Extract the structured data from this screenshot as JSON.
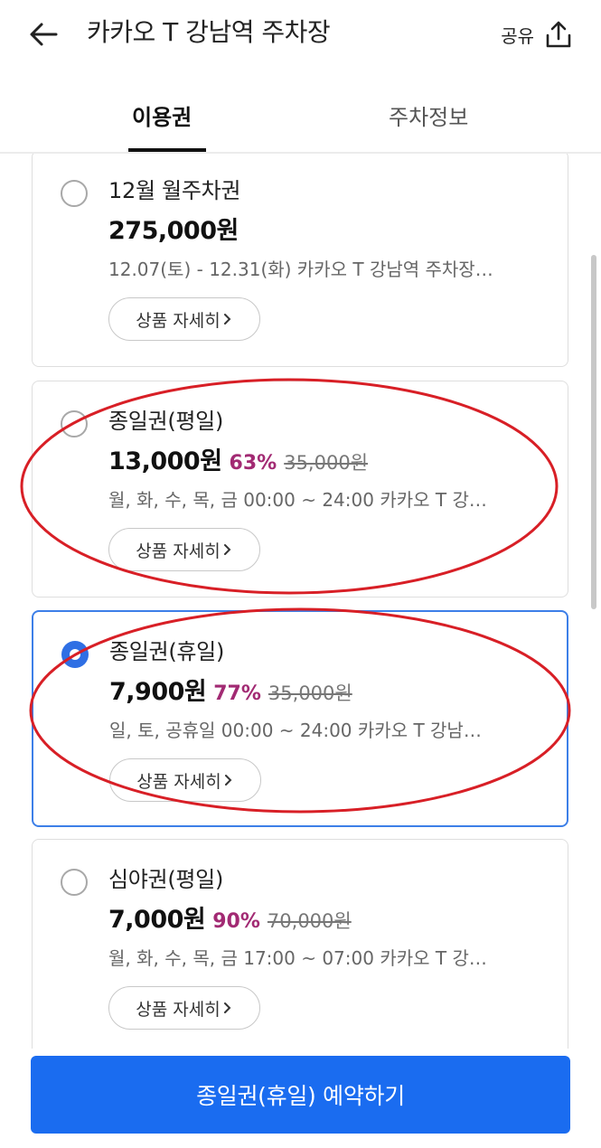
{
  "header": {
    "title": "카카오 T 강남역 주차장",
    "share_label": "공유"
  },
  "tabs": [
    {
      "label": "이용권",
      "active": true
    },
    {
      "label": "주차정보",
      "active": false
    }
  ],
  "tickets": [
    {
      "name": "12월 월주차권",
      "price": "275,000원",
      "discount": "",
      "original_price": "",
      "description": "12.07(토) - 12.31(화) 카카오 T 강남역 주차장…",
      "detail_label": "상품 자세히",
      "selected": false
    },
    {
      "name": "종일권(평일)",
      "price": "13,000원",
      "discount": "63%",
      "original_price": "35,000원",
      "description": "월, 화, 수, 목, 금 00:00 ~ 24:00 카카오 T 강…",
      "detail_label": "상품 자세히",
      "selected": false
    },
    {
      "name": "종일권(휴일)",
      "price": "7,900원",
      "discount": "77%",
      "original_price": "35,000원",
      "description": "일, 토, 공휴일 00:00 ~ 24:00 카카오 T 강남…",
      "detail_label": "상품 자세히",
      "selected": true
    },
    {
      "name": "심야권(평일)",
      "price": "7,000원",
      "discount": "90%",
      "original_price": "70,000원",
      "description": "월, 화, 수, 목, 금 17:00 ~ 07:00 카카오 T 강…",
      "detail_label": "상품 자세히",
      "selected": false
    }
  ],
  "cta": {
    "label": "종일권(휴일) 예약하기"
  },
  "colors": {
    "accent": "#1a6cf0",
    "selected_border": "#3d7fe8",
    "discount": "#a22a73",
    "annotation": "#d81f26"
  },
  "icons": [
    "back-arrow-icon",
    "share-icon",
    "radio-icon",
    "chevron-right-icon"
  ]
}
